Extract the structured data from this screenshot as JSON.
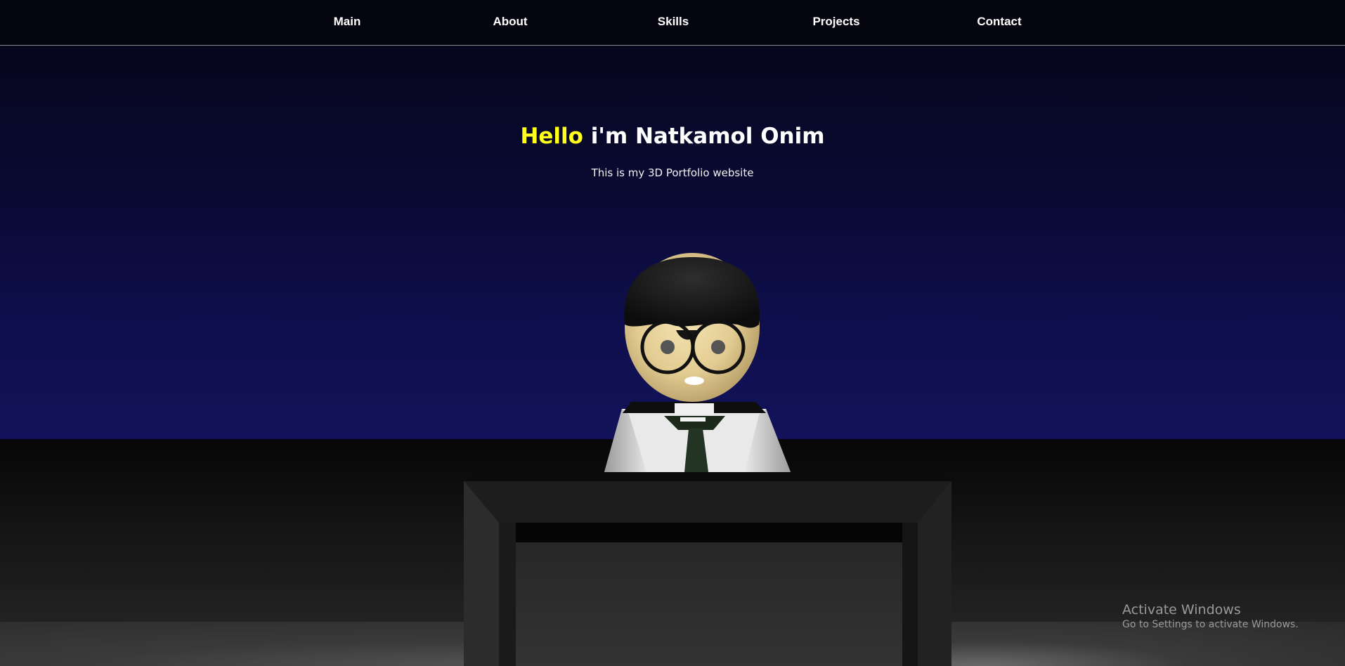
{
  "nav": {
    "items": [
      {
        "label": "Main"
      },
      {
        "label": "About"
      },
      {
        "label": "Skills"
      },
      {
        "label": "Projects"
      },
      {
        "label": "Contact"
      }
    ]
  },
  "hero": {
    "greeting": "Hello",
    "name_line": " i'm Natkamol Onim",
    "subtitle": "This is my 3D Portfolio website"
  },
  "watermark": {
    "title": "Activate Windows",
    "subtitle": "Go to Settings to activate Windows."
  },
  "colors": {
    "accent": "#ffff1a",
    "sky_top": "#060619",
    "sky_bottom": "#12125a"
  }
}
